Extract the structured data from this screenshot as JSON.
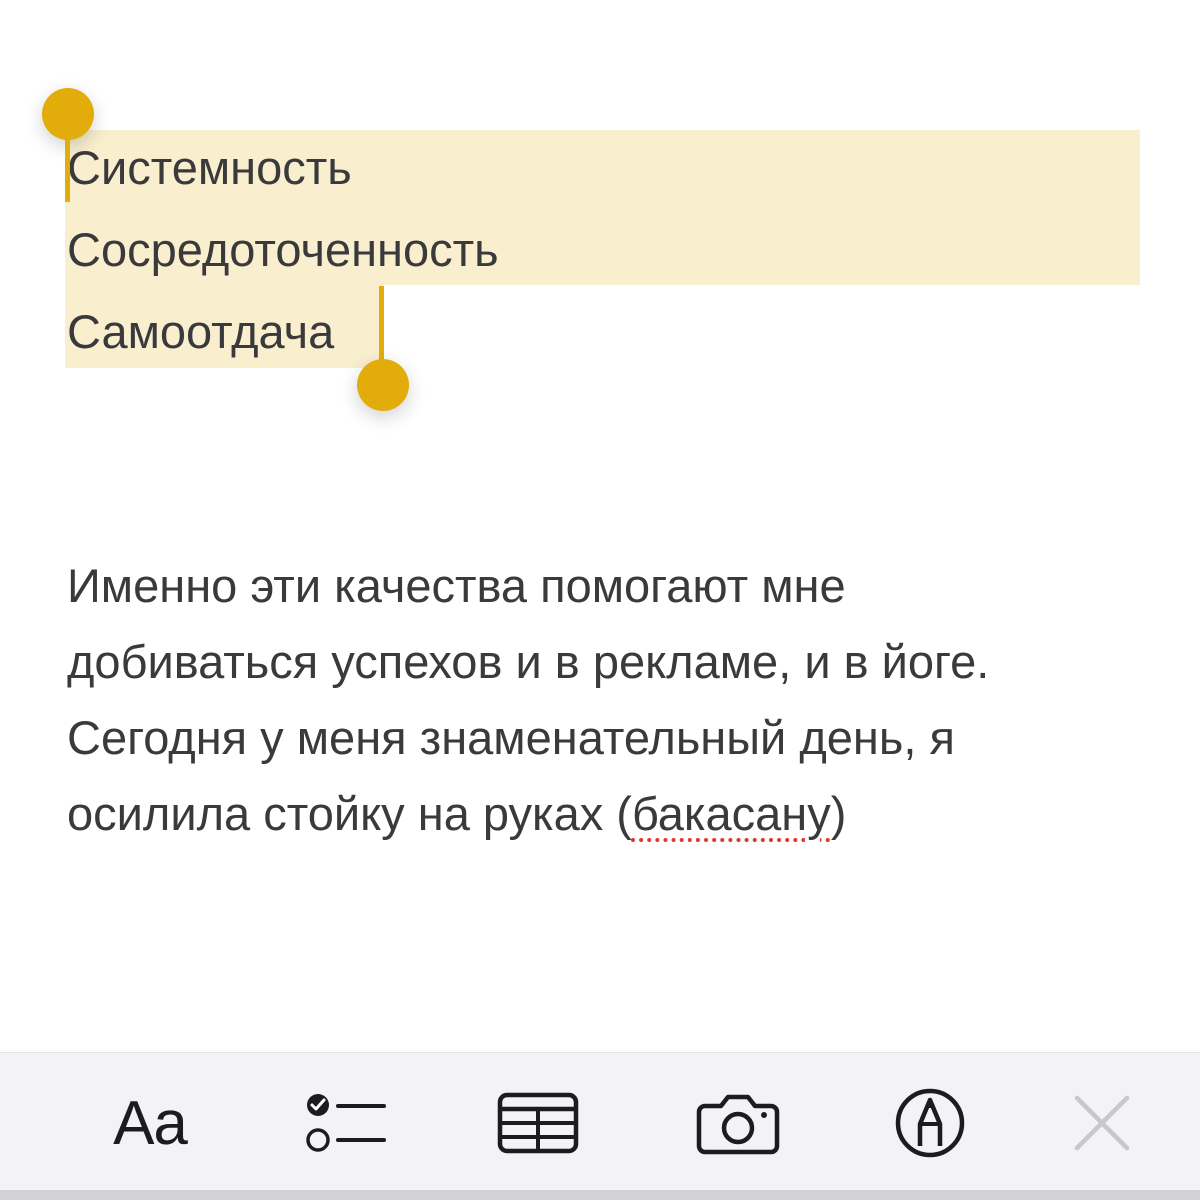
{
  "note": {
    "selected_lines": [
      "Системность",
      "Сосредоточенность",
      "Самоотдача"
    ],
    "paragraph_lines": [
      "Именно эти качества помогают мне",
      "добиваться успехов и в рекламе, и в йоге.",
      "Сегодня у меня знаменательный день, я"
    ],
    "last_line_before": "осилила стойку на руках (",
    "last_line_misspelled": "бакасану",
    "last_line_after": ")"
  },
  "colors": {
    "selection_highlight": "#f9efcf",
    "selection_handle": "#e2ac0b",
    "text": "#3a3a3c",
    "toolbar_bg": "#f2f2f7",
    "spellcheck_underline": "#e0392b"
  },
  "toolbar": {
    "format_label": "Aa",
    "icons": [
      "format-text-icon",
      "checklist-icon",
      "table-icon",
      "camera-icon",
      "markup-pen-icon",
      "close-icon"
    ]
  }
}
